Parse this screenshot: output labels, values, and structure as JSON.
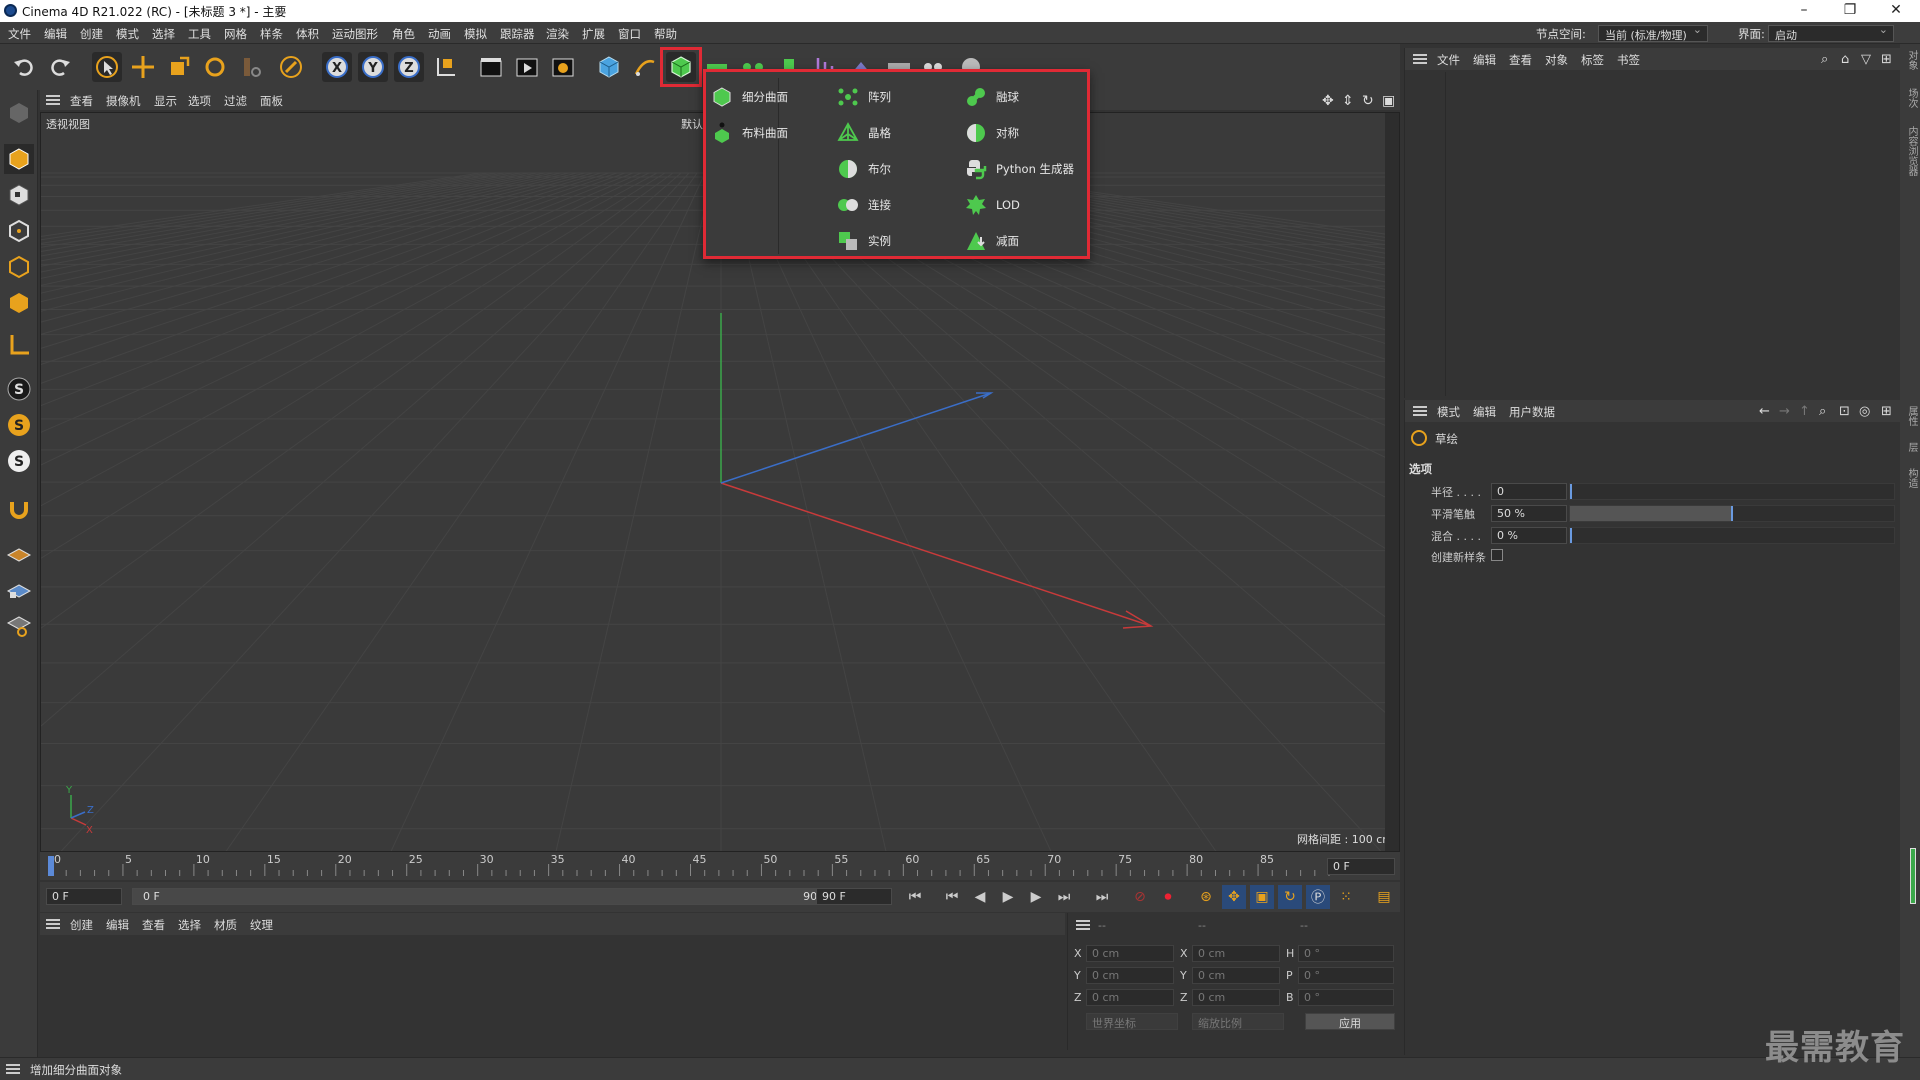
{
  "window": {
    "title": "Cinema 4D R21.022 (RC) - [未标题 3 *] - 主要"
  },
  "menubar": {
    "items": [
      "文件",
      "编辑",
      "创建",
      "模式",
      "选择",
      "工具",
      "网格",
      "样条",
      "体积",
      "运动图形",
      "角色",
      "动画",
      "模拟",
      "跟踪器",
      "渲染",
      "扩展",
      "窗口",
      "帮助"
    ],
    "node_space_label": "节点空间:",
    "node_space_value": "当前 (标准/物理)",
    "layout_label": "界面:",
    "layout_value": "启动"
  },
  "viewport": {
    "menu": [
      "查看",
      "摄像机",
      "显示",
      "选项",
      "过滤",
      "面板"
    ],
    "label": "透视视图",
    "default_label": "默认",
    "grid_info": "网格间距 : 100 cm",
    "axis_y": "Y",
    "axis_z": "Z",
    "axis_x": "X"
  },
  "popup": {
    "col1": [
      "细分曲面",
      "布料曲面"
    ],
    "col2": [
      "阵列",
      "晶格",
      "布尔",
      "连接",
      "实例"
    ],
    "col3": [
      "融球",
      "对称",
      "Python 生成器",
      "LOD",
      "减面"
    ]
  },
  "timeline": {
    "ticks": [
      "0",
      "5",
      "10",
      "15",
      "20",
      "25",
      "30",
      "35",
      "40",
      "45",
      "50",
      "55",
      "60",
      "65",
      "70",
      "75",
      "80",
      "85",
      "90"
    ],
    "current_frame": "0 F",
    "start": "0 F",
    "min": "0 F",
    "max": "90 F",
    "end": "90 F"
  },
  "material_menu": [
    "创建",
    "编辑",
    "查看",
    "选择",
    "材质",
    "纹理"
  ],
  "coords": {
    "header1": "--",
    "header2": "--",
    "header3": "--",
    "rows": [
      {
        "a": "X",
        "av": "0 cm",
        "b": "X",
        "bv": "0 cm",
        "c": "H",
        "cv": "0 °"
      },
      {
        "a": "Y",
        "av": "0 cm",
        "b": "Y",
        "bv": "0 cm",
        "c": "P",
        "cv": "0 °"
      },
      {
        "a": "Z",
        "av": "0 cm",
        "b": "Z",
        "bv": "0 cm",
        "c": "B",
        "cv": "0 °"
      }
    ],
    "world": "世界坐标",
    "scale": "缩放比例",
    "apply": "应用"
  },
  "object_panel": {
    "menu": [
      "文件",
      "编辑",
      "查看",
      "对象",
      "标签",
      "书签"
    ]
  },
  "attr_panel": {
    "menu": [
      "模式",
      "编辑",
      "用户数据"
    ],
    "tool_name": "草绘",
    "section": "选项",
    "fields": [
      {
        "label": "半径 . . . .",
        "value": "0",
        "fill": 0
      },
      {
        "label": "平滑笔触",
        "value": "50 %",
        "fill": 0.5
      },
      {
        "label": "混合 . . . .",
        "value": "0 %",
        "fill": 0
      }
    ],
    "checkbox_label": "创建新样条"
  },
  "right_tabs": [
    "对象",
    "场次",
    "内容浏览器",
    "属性",
    "层",
    "构造"
  ],
  "status": "增加细分曲面对象",
  "watermark": "最需教育",
  "colors": {
    "highlight": "#e02a35",
    "accent_green": "#4ec94e",
    "axis_x": "#c83a3a",
    "axis_y": "#3aa84a",
    "axis_z": "#3a6ec8"
  }
}
